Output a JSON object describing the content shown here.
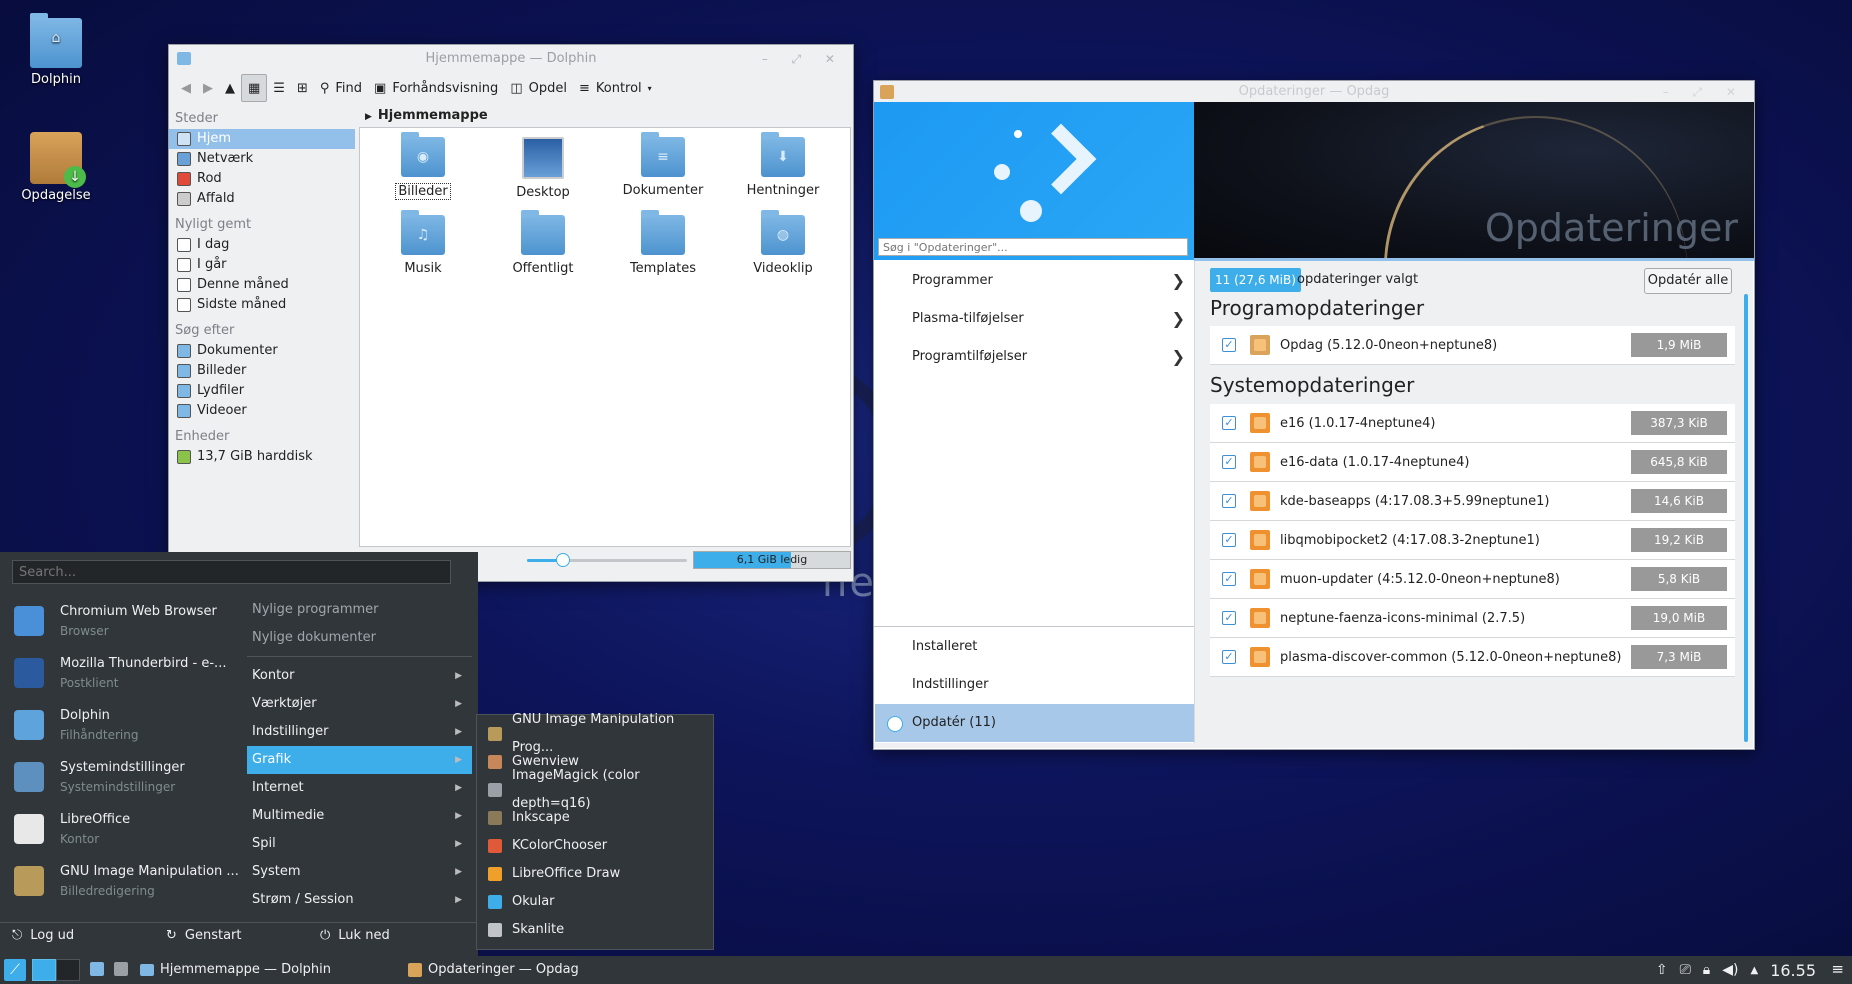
{
  "desktop": {
    "icons": [
      {
        "label": "Dolphin"
      },
      {
        "label": "Opdagelse"
      }
    ],
    "bg_logo_text": "ne"
  },
  "dolphin": {
    "title": "Hjemmemappe — Dolphin",
    "toolbar": {
      "find": "Find",
      "preview": "Forhåndsvisning",
      "split": "Opdel",
      "control": "Kontrol"
    },
    "sidebar": {
      "places_header": "Steder",
      "places": [
        "Hjem",
        "Netværk",
        "Rod",
        "Affald"
      ],
      "recent_header": "Nyligt gemt",
      "recent": [
        "I dag",
        "I går",
        "Denne måned",
        "Sidste måned"
      ],
      "search_header": "Søg efter",
      "search": [
        "Dokumenter",
        "Billeder",
        "Lydfiler",
        "Videoer"
      ],
      "devices_header": "Enheder",
      "devices": [
        "13,7 GiB harddisk"
      ]
    },
    "breadcrumb": "Hjemmemappe",
    "files": [
      "Billeder",
      "Desktop",
      "Dokumenter",
      "Hentninger",
      "Musik",
      "Offentligt",
      "Templates",
      "Videoklip"
    ],
    "free_space": "6,1 GiB ledig",
    "free_space_fraction": 0.62,
    "zoom_fraction": 0.22
  },
  "discover": {
    "title": "Opdateringer — Opdag",
    "search_placeholder": "Søg i \"Opdateringer\"...",
    "banner_title": "Opdateringer",
    "nav": [
      "Programmer",
      "Plasma-tilføjelser",
      "Programtilføjelser"
    ],
    "bottom_nav": [
      "Installeret",
      "Indstillinger",
      "Opdatér (11)"
    ],
    "selected_badge": "11 (27,6 MiB)",
    "selected_text": "opdateringer valgt",
    "update_all": "Opdatér alle",
    "section_apps": "Programopdateringer",
    "section_system": "Systemopdateringer",
    "app_updates": [
      {
        "name": "Opdag (5.12.0-0neon+neptune8)",
        "size": "1,9 MiB"
      }
    ],
    "system_updates": [
      {
        "name": "e16 (1.0.17-4neptune4)",
        "size": "387,3 KiB"
      },
      {
        "name": "e16-data (1.0.17-4neptune4)",
        "size": "645,8 KiB"
      },
      {
        "name": "kde-baseapps (4:17.08.3+5.99neptune1)",
        "size": "14,6 KiB"
      },
      {
        "name": "libqmobipocket2 (4:17.08.3-2neptune1)",
        "size": "19,2 KiB"
      },
      {
        "name": "muon-updater (4:5.12.0-0neon+neptune8)",
        "size": "5,8 KiB"
      },
      {
        "name": "neptune-faenza-icons-minimal (2.7.5)",
        "size": "19,0 MiB"
      },
      {
        "name": "plasma-discover-common (5.12.0-0neon+neptune8)",
        "size": "7,3 MiB"
      }
    ]
  },
  "launcher": {
    "search_placeholder": "Search...",
    "favorites": [
      {
        "name": "Chromium Web Browser",
        "sub": "Browser",
        "color": "#4a90d9"
      },
      {
        "name": "Mozilla Thunderbird - e-...",
        "sub": "Postklient",
        "color": "#2c5a9e"
      },
      {
        "name": "Dolphin",
        "sub": "Filhåndtering",
        "color": "#5fa3dd"
      },
      {
        "name": "Systemindstillinger",
        "sub": "Systemindstillinger",
        "color": "#5d8fbf"
      },
      {
        "name": "LibreOffice",
        "sub": "Kontor",
        "color": "#e8e8e8"
      },
      {
        "name": "GNU Image Manipulation ...",
        "sub": "Billedredigering",
        "color": "#b89a5a"
      }
    ],
    "recent_apps": "Nylige programmer",
    "recent_docs": "Nylige dokumenter",
    "categories": [
      "Kontor",
      "Værktøjer",
      "Indstillinger",
      "Grafik",
      "Internet",
      "Multimedie",
      "Spil",
      "System",
      "Strøm / Session"
    ],
    "highlighted_category": "Grafik",
    "graphics_apps": [
      {
        "name": "GNU Image Manipulation Prog...",
        "color": "#b89a5a"
      },
      {
        "name": "Gwenview",
        "color": "#c8875a"
      },
      {
        "name": "ImageMagick (color depth=q16)",
        "color": "#9aa0a6"
      },
      {
        "name": "Inkscape",
        "color": "#8a7a5a"
      },
      {
        "name": "KColorChooser",
        "color": "#e05a3a"
      },
      {
        "name": "LibreOffice Draw",
        "color": "#f0a02a"
      },
      {
        "name": "Okular",
        "color": "#3daee9"
      },
      {
        "name": "Skanlite",
        "color": "#c0c4c8"
      }
    ],
    "logout": "Log ud",
    "restart": "Genstart",
    "shutdown": "Luk ned"
  },
  "taskbar": {
    "tasks": [
      "Hjemmemappe — Dolphin",
      "Opdateringer — Opdag"
    ],
    "clock": "16.55"
  },
  "colors": {
    "accent": "#3daee9",
    "selection": "#93c0ea",
    "menu_bg": "#31363b"
  }
}
